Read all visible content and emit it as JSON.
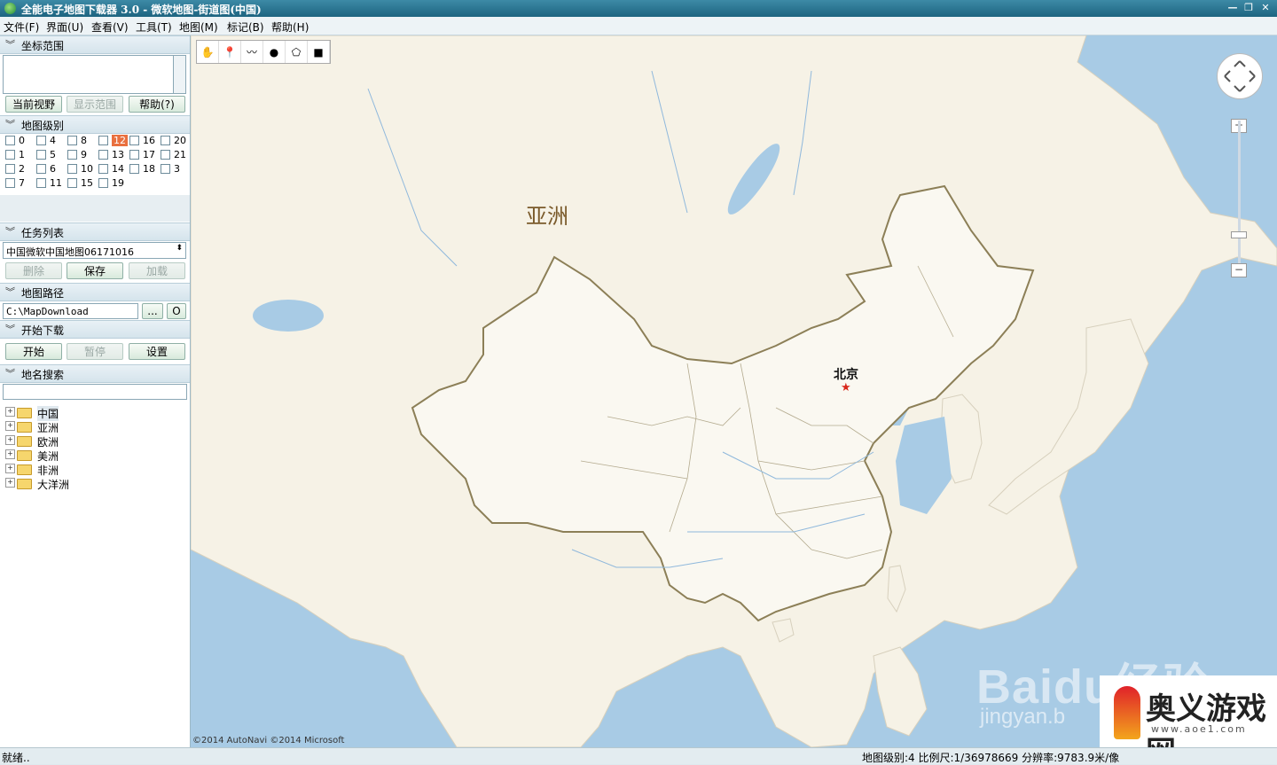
{
  "window": {
    "title": "全能电子地图下载器 3.0 - 微软地图-街道图(中国)"
  },
  "menu": [
    "文件(F)",
    "界面(U)",
    "查看(V)",
    "工具(T)",
    "地图(M)",
    "标记(B)",
    "帮助(H)"
  ],
  "sections": {
    "coord_range": "坐标范围",
    "map_level": "地图级别",
    "task_list": "任务列表",
    "map_path": "地图路径",
    "start_download": "开始下载",
    "place_search": "地名搜索"
  },
  "coord_buttons": {
    "current_view": "当前视野",
    "show_range": "显示范围",
    "help": "帮助(?)"
  },
  "levels": [
    {
      "label": "0",
      "checked": false,
      "highlight": false
    },
    {
      "label": "4",
      "checked": false,
      "highlight": false
    },
    {
      "label": "8",
      "checked": false,
      "highlight": false
    },
    {
      "label": "12",
      "checked": false,
      "highlight": true
    },
    {
      "label": "16",
      "checked": false,
      "highlight": false
    },
    {
      "label": "20",
      "checked": false,
      "highlight": false
    },
    {
      "label": "1",
      "checked": false,
      "highlight": false
    },
    {
      "label": "5",
      "checked": false,
      "highlight": false
    },
    {
      "label": "9",
      "checked": false,
      "highlight": false
    },
    {
      "label": "13",
      "checked": false,
      "highlight": false
    },
    {
      "label": "17",
      "checked": false,
      "highlight": false
    },
    {
      "label": "21",
      "checked": false,
      "highlight": false
    },
    {
      "label": "2",
      "checked": false,
      "highlight": false
    },
    {
      "label": "6",
      "checked": false,
      "highlight": false
    },
    {
      "label": "10",
      "checked": false,
      "highlight": false
    },
    {
      "label": "14",
      "checked": false,
      "highlight": false
    },
    {
      "label": "18",
      "checked": false,
      "highlight": false
    },
    {
      "label": "3",
      "checked": false,
      "highlight": false
    },
    {
      "label": "7",
      "checked": false,
      "highlight": false
    },
    {
      "label": "11",
      "checked": false,
      "highlight": false
    },
    {
      "label": "15",
      "checked": false,
      "highlight": false
    },
    {
      "label": "19",
      "checked": false,
      "highlight": false
    }
  ],
  "task": {
    "selected": "中国微软中国地图06171016",
    "delete": "删除",
    "save": "保存",
    "load": "加载"
  },
  "path": {
    "value": "C:\\MapDownload",
    "browse": "...",
    "open": "O"
  },
  "download": {
    "start": "开始",
    "pause": "暂停",
    "settings": "设置"
  },
  "search": {
    "value": ""
  },
  "tree": [
    "中国",
    "亚洲",
    "欧洲",
    "美洲",
    "非洲",
    "大洋洲"
  ],
  "map": {
    "label_asia": "亚洲",
    "label_beijing": "北京",
    "copyright": "©2014 AutoNavi ©2014 Microsoft",
    "zoom_in": "+",
    "zoom_out": "−",
    "watermark_baidu": "Baidu经验",
    "watermark_jingyan": "jingyan.b",
    "logo_brand": "奥义游戏网",
    "logo_site": "www.aoe1.com",
    "colors": {
      "water": "#a8cbe5",
      "land": "#f6f2e6",
      "border": "#8c7f57",
      "highlight": "#e9703f"
    }
  },
  "status": {
    "left": "就绪..",
    "right": "地图级别:4 比例尺:1/36978669 分辨率:9783.9米/像"
  }
}
